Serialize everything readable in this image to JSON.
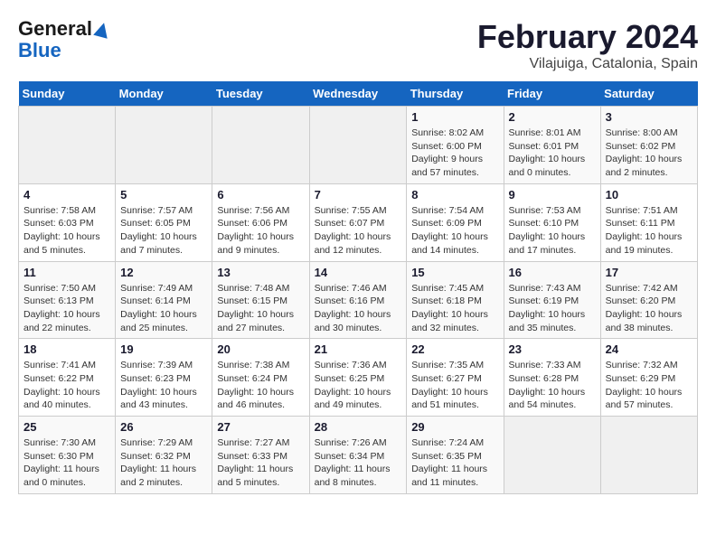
{
  "header": {
    "logo_line1": "General",
    "logo_line2": "Blue",
    "month": "February 2024",
    "location": "Vilajuiga, Catalonia, Spain"
  },
  "weekdays": [
    "Sunday",
    "Monday",
    "Tuesday",
    "Wednesday",
    "Thursday",
    "Friday",
    "Saturday"
  ],
  "weeks": [
    [
      {
        "day": "",
        "info": ""
      },
      {
        "day": "",
        "info": ""
      },
      {
        "day": "",
        "info": ""
      },
      {
        "day": "",
        "info": ""
      },
      {
        "day": "1",
        "info": "Sunrise: 8:02 AM\nSunset: 6:00 PM\nDaylight: 9 hours and 57 minutes."
      },
      {
        "day": "2",
        "info": "Sunrise: 8:01 AM\nSunset: 6:01 PM\nDaylight: 10 hours and 0 minutes."
      },
      {
        "day": "3",
        "info": "Sunrise: 8:00 AM\nSunset: 6:02 PM\nDaylight: 10 hours and 2 minutes."
      }
    ],
    [
      {
        "day": "4",
        "info": "Sunrise: 7:58 AM\nSunset: 6:03 PM\nDaylight: 10 hours and 5 minutes."
      },
      {
        "day": "5",
        "info": "Sunrise: 7:57 AM\nSunset: 6:05 PM\nDaylight: 10 hours and 7 minutes."
      },
      {
        "day": "6",
        "info": "Sunrise: 7:56 AM\nSunset: 6:06 PM\nDaylight: 10 hours and 9 minutes."
      },
      {
        "day": "7",
        "info": "Sunrise: 7:55 AM\nSunset: 6:07 PM\nDaylight: 10 hours and 12 minutes."
      },
      {
        "day": "8",
        "info": "Sunrise: 7:54 AM\nSunset: 6:09 PM\nDaylight: 10 hours and 14 minutes."
      },
      {
        "day": "9",
        "info": "Sunrise: 7:53 AM\nSunset: 6:10 PM\nDaylight: 10 hours and 17 minutes."
      },
      {
        "day": "10",
        "info": "Sunrise: 7:51 AM\nSunset: 6:11 PM\nDaylight: 10 hours and 19 minutes."
      }
    ],
    [
      {
        "day": "11",
        "info": "Sunrise: 7:50 AM\nSunset: 6:13 PM\nDaylight: 10 hours and 22 minutes."
      },
      {
        "day": "12",
        "info": "Sunrise: 7:49 AM\nSunset: 6:14 PM\nDaylight: 10 hours and 25 minutes."
      },
      {
        "day": "13",
        "info": "Sunrise: 7:48 AM\nSunset: 6:15 PM\nDaylight: 10 hours and 27 minutes."
      },
      {
        "day": "14",
        "info": "Sunrise: 7:46 AM\nSunset: 6:16 PM\nDaylight: 10 hours and 30 minutes."
      },
      {
        "day": "15",
        "info": "Sunrise: 7:45 AM\nSunset: 6:18 PM\nDaylight: 10 hours and 32 minutes."
      },
      {
        "day": "16",
        "info": "Sunrise: 7:43 AM\nSunset: 6:19 PM\nDaylight: 10 hours and 35 minutes."
      },
      {
        "day": "17",
        "info": "Sunrise: 7:42 AM\nSunset: 6:20 PM\nDaylight: 10 hours and 38 minutes."
      }
    ],
    [
      {
        "day": "18",
        "info": "Sunrise: 7:41 AM\nSunset: 6:22 PM\nDaylight: 10 hours and 40 minutes."
      },
      {
        "day": "19",
        "info": "Sunrise: 7:39 AM\nSunset: 6:23 PM\nDaylight: 10 hours and 43 minutes."
      },
      {
        "day": "20",
        "info": "Sunrise: 7:38 AM\nSunset: 6:24 PM\nDaylight: 10 hours and 46 minutes."
      },
      {
        "day": "21",
        "info": "Sunrise: 7:36 AM\nSunset: 6:25 PM\nDaylight: 10 hours and 49 minutes."
      },
      {
        "day": "22",
        "info": "Sunrise: 7:35 AM\nSunset: 6:27 PM\nDaylight: 10 hours and 51 minutes."
      },
      {
        "day": "23",
        "info": "Sunrise: 7:33 AM\nSunset: 6:28 PM\nDaylight: 10 hours and 54 minutes."
      },
      {
        "day": "24",
        "info": "Sunrise: 7:32 AM\nSunset: 6:29 PM\nDaylight: 10 hours and 57 minutes."
      }
    ],
    [
      {
        "day": "25",
        "info": "Sunrise: 7:30 AM\nSunset: 6:30 PM\nDaylight: 11 hours and 0 minutes."
      },
      {
        "day": "26",
        "info": "Sunrise: 7:29 AM\nSunset: 6:32 PM\nDaylight: 11 hours and 2 minutes."
      },
      {
        "day": "27",
        "info": "Sunrise: 7:27 AM\nSunset: 6:33 PM\nDaylight: 11 hours and 5 minutes."
      },
      {
        "day": "28",
        "info": "Sunrise: 7:26 AM\nSunset: 6:34 PM\nDaylight: 11 hours and 8 minutes."
      },
      {
        "day": "29",
        "info": "Sunrise: 7:24 AM\nSunset: 6:35 PM\nDaylight: 11 hours and 11 minutes."
      },
      {
        "day": "",
        "info": ""
      },
      {
        "day": "",
        "info": ""
      }
    ]
  ]
}
